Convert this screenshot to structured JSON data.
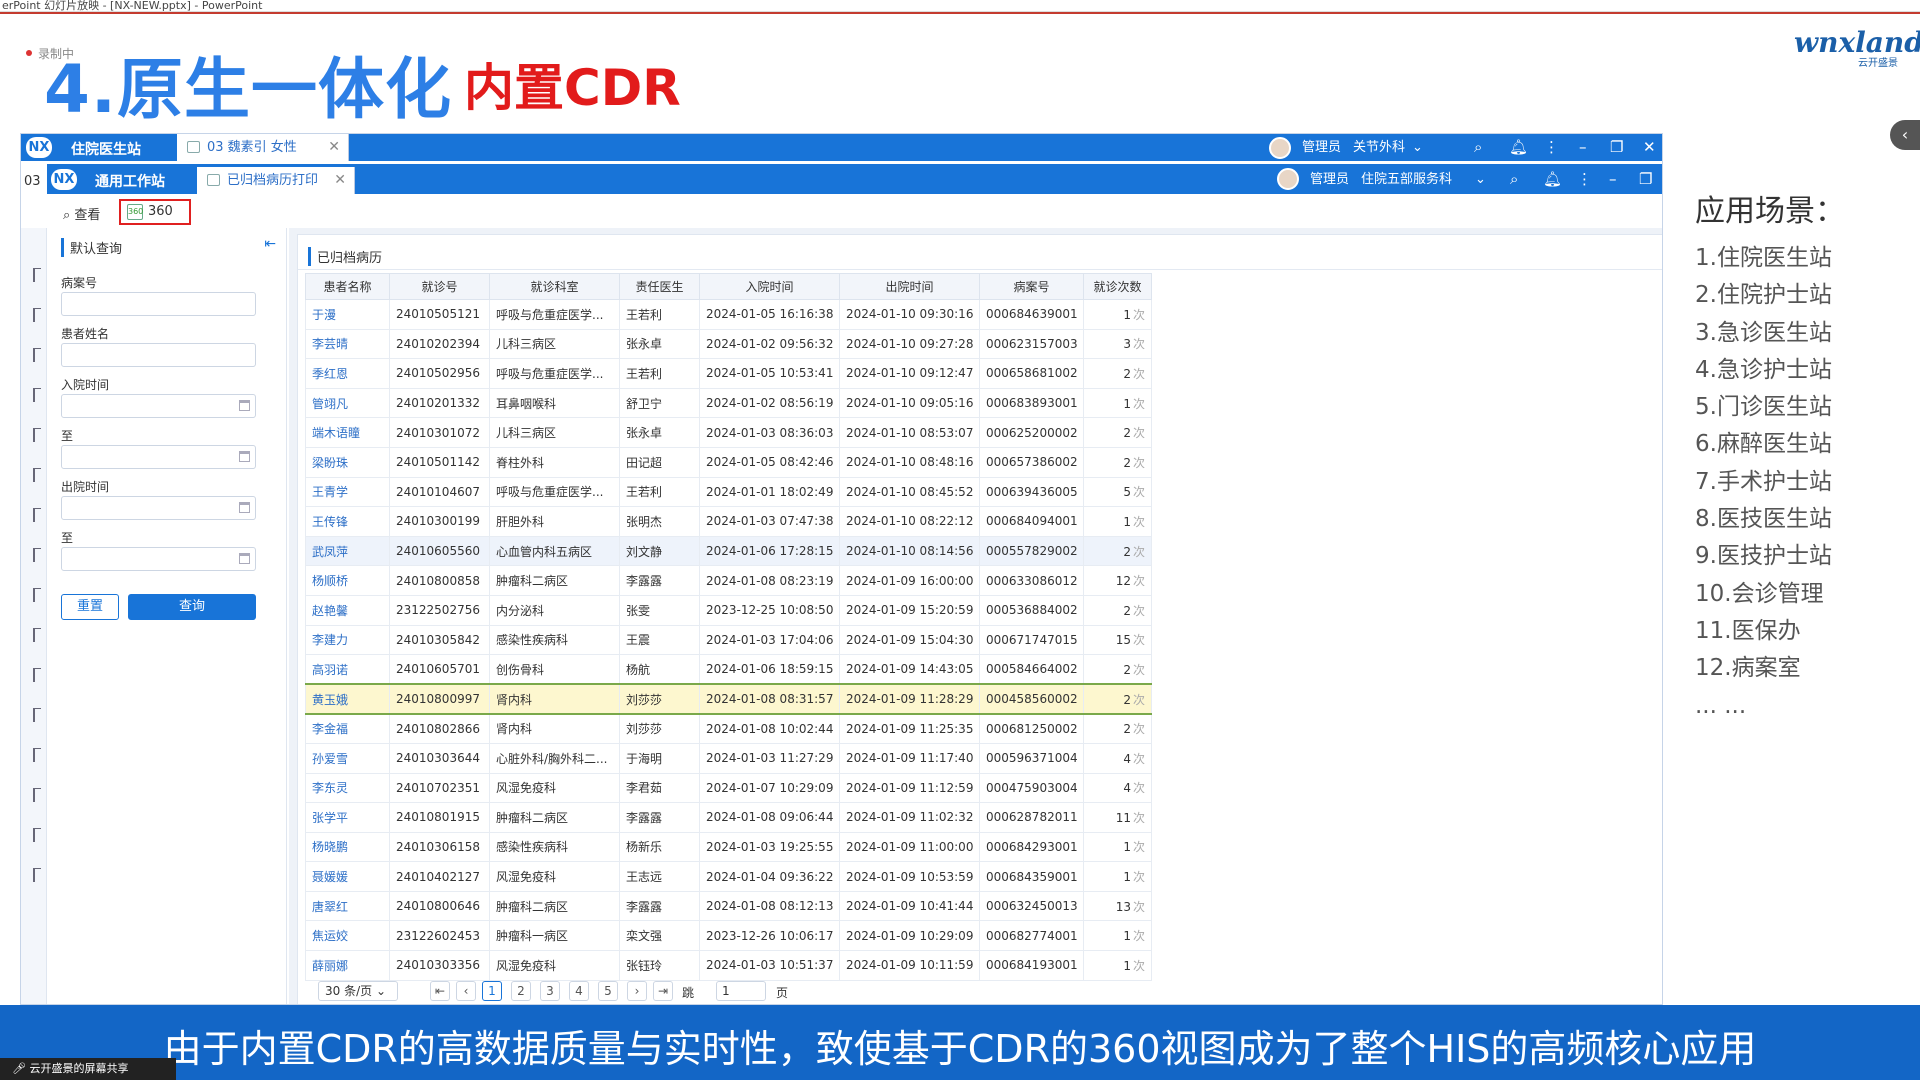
{
  "window_title": "erPoint 幻灯片放映 - [NX-NEW.pptx] - PowerPoint",
  "slide": {
    "rec_label": "录制中",
    "title": "4.原生一体化",
    "subtitle": "内置CDR",
    "logo_text": "wnxland",
    "logo_sub": "云开盛景",
    "caption": "由于内置CDR的高数据质量与实时性，致使基于CDR的360视图成为了整个HIS的高频核心应用",
    "share_label": "云开盛景的屏幕共享"
  },
  "app": {
    "bar1": {
      "logo": "NX",
      "title": "住院医生站",
      "tab": "03 魏素引 女性",
      "user_role": "管理员",
      "dept": "关节外科"
    },
    "bar2": {
      "logo": "NX",
      "title": "通用工作站",
      "tab": "已归档病历打印",
      "user_role": "管理员",
      "dept": "住院五部服务科"
    },
    "left_label": "03",
    "toolbar": {
      "view": "查看",
      "btn360": "360"
    },
    "query": {
      "header": "默认查询",
      "fields": [
        "病案号",
        "患者姓名",
        "入院时间",
        "至",
        "出院时间",
        "至"
      ],
      "reset": "重置",
      "search": "查询"
    },
    "list": {
      "header": "已归档病历",
      "columns": [
        "患者名称",
        "就诊号",
        "就诊科室",
        "责任医生",
        "入院时间",
        "出院时间",
        "病案号",
        "就诊次数"
      ],
      "unit": "次",
      "rows": [
        [
          "于漫",
          "24010505121",
          "呼吸与危重症医学...",
          "王若利",
          "2024-01-05 16:16:38",
          "2024-01-10 09:30:16",
          "000684639001",
          "1"
        ],
        [
          "李芸晴",
          "24010202394",
          "儿科三病区",
          "张永卓",
          "2024-01-02 09:56:32",
          "2024-01-10 09:27:28",
          "000623157003",
          "3"
        ],
        [
          "季红恩",
          "24010502956",
          "呼吸与危重症医学...",
          "王若利",
          "2024-01-05 10:53:41",
          "2024-01-10 09:12:47",
          "000658681002",
          "2"
        ],
        [
          "管翊凡",
          "24010201332",
          "耳鼻咽喉科",
          "舒卫宁",
          "2024-01-02 08:56:19",
          "2024-01-10 09:05:16",
          "000683893001",
          "1"
        ],
        [
          "端木语瞳",
          "24010301072",
          "儿科三病区",
          "张永卓",
          "2024-01-03 08:36:03",
          "2024-01-10 08:53:07",
          "000625200002",
          "2"
        ],
        [
          "梁盼珠",
          "24010501142",
          "脊柱外科",
          "田记超",
          "2024-01-05 08:42:46",
          "2024-01-10 08:48:16",
          "000657386002",
          "2"
        ],
        [
          "王青学",
          "24010104607",
          "呼吸与危重症医学...",
          "王若利",
          "2024-01-01 18:02:49",
          "2024-01-10 08:45:52",
          "000639436005",
          "5"
        ],
        [
          "王传锋",
          "24010300199",
          "肝胆外科",
          "张明杰",
          "2024-01-03 07:47:38",
          "2024-01-10 08:22:12",
          "000684094001",
          "1"
        ],
        [
          "武凤萍",
          "24010605560",
          "心血管内科五病区",
          "刘文静",
          "2024-01-06 17:28:15",
          "2024-01-10 08:14:56",
          "000557829002",
          "2"
        ],
        [
          "杨顺桥",
          "24010800858",
          "肿瘤科二病区",
          "李露露",
          "2024-01-08 08:23:19",
          "2024-01-09 16:00:00",
          "000633086012",
          "12"
        ],
        [
          "赵艳馨",
          "23122502756",
          "内分泌科",
          "张雯",
          "2023-12-25 10:08:50",
          "2024-01-09 15:20:59",
          "000536884002",
          "2"
        ],
        [
          "李建力",
          "24010305842",
          "感染性疾病科",
          "王震",
          "2024-01-03 17:04:06",
          "2024-01-09 15:04:30",
          "000671747015",
          "15"
        ],
        [
          "高羽诺",
          "24010605701",
          "创伤骨科",
          "杨航",
          "2024-01-06 18:59:15",
          "2024-01-09 14:43:05",
          "000584664002",
          "2"
        ],
        [
          "黄玉娥",
          "24010800997",
          "肾内科",
          "刘莎莎",
          "2024-01-08 08:31:57",
          "2024-01-09 11:28:29",
          "000458560002",
          "2"
        ],
        [
          "李金福",
          "24010802866",
          "肾内科",
          "刘莎莎",
          "2024-01-08 10:02:44",
          "2024-01-09 11:25:35",
          "000681250002",
          "2"
        ],
        [
          "孙爱雪",
          "24010303644",
          "心脏外科/胸外科二...",
          "于海明",
          "2024-01-03 11:27:29",
          "2024-01-09 11:17:40",
          "000596371004",
          "4"
        ],
        [
          "李东灵",
          "24010702351",
          "风湿免疫科",
          "李君茹",
          "2024-01-07 10:29:09",
          "2024-01-09 11:12:59",
          "000475903004",
          "4"
        ],
        [
          "张学平",
          "24010801915",
          "肿瘤科二病区",
          "李露露",
          "2024-01-08 09:06:44",
          "2024-01-09 11:02:32",
          "000628782011",
          "11"
        ],
        [
          "杨晓鹏",
          "24010306158",
          "感染性疾病科",
          "杨新乐",
          "2024-01-03 19:25:55",
          "2024-01-09 11:00:00",
          "000684293001",
          "1"
        ],
        [
          "聂媛媛",
          "24010402127",
          "风湿免疫科",
          "王志远",
          "2024-01-04 09:36:22",
          "2024-01-09 10:53:59",
          "000684359001",
          "1"
        ],
        [
          "唐翠红",
          "24010800646",
          "肿瘤科二病区",
          "李露露",
          "2024-01-08 08:12:13",
          "2024-01-09 10:41:44",
          "000632450013",
          "13"
        ],
        [
          "焦运姣",
          "23122602453",
          "肿瘤科一病区",
          "栾文强",
          "2023-12-26 10:06:17",
          "2024-01-09 10:29:09",
          "000682774001",
          "1"
        ],
        [
          "薛丽娜",
          "24010303356",
          "风湿免疫科",
          "张钰玲",
          "2024-01-03 10:51:37",
          "2024-01-09 10:11:59",
          "000684193001",
          "1"
        ]
      ],
      "selected_row": 13
    },
    "pager": {
      "size": "30 条/页",
      "pages": [
        "1",
        "2",
        "3",
        "4",
        "5"
      ],
      "current": "1",
      "jump": "跳至",
      "jump_value": "1",
      "unit": "页"
    }
  },
  "scenes": {
    "title": "应用场景：",
    "items": [
      "1.住院医生站",
      "2.住院护士站",
      "3.急诊医生站",
      "4.急诊护士站",
      "5.门诊医生站",
      "6.麻醉医生站",
      "7.手术护士站",
      "8.医技医生站",
      "9.医技护士站",
      "10.会诊管理",
      "11.医保办",
      "12.病案室",
      "... ..."
    ]
  },
  "colors": {
    "accent": "#1874d8",
    "title_blue": "#2d7fe6",
    "title_red": "#e21b1b",
    "caption_bg": "#1366c6"
  }
}
